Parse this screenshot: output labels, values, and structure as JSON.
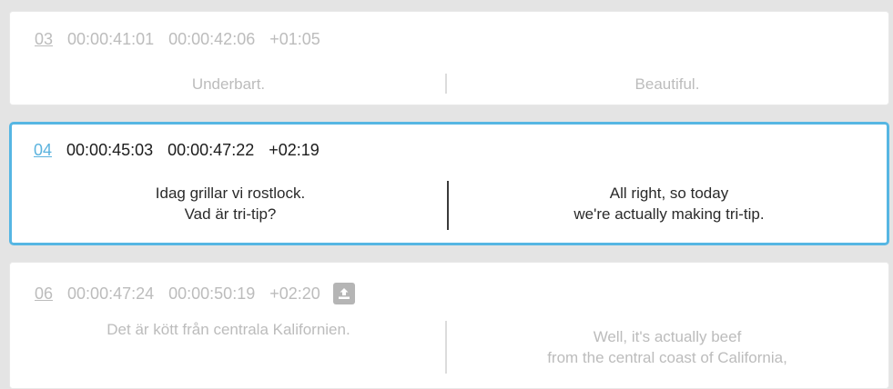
{
  "subtitles": [
    {
      "number": "03",
      "in": "00:00:41:01",
      "out": "00:00:42:06",
      "duration": "+01:05",
      "source_lines": [
        "Underbart."
      ],
      "target_lines": [
        "Beautiful."
      ],
      "state": "inactive"
    },
    {
      "number": "04",
      "in": "00:00:45:03",
      "out": "00:00:47:22",
      "duration": "+02:19",
      "source_lines": [
        "Idag grillar vi rostlock.",
        "Vad är tri-tip?"
      ],
      "target_lines": [
        "All right, so today",
        "we're actually making tri-tip."
      ],
      "state": "active"
    },
    {
      "number": "06",
      "in": "00:00:47:24",
      "out": "00:00:50:19",
      "duration": "+02:20",
      "source_lines": [
        "Det är kött från centrala Kalifornien."
      ],
      "target_lines": [
        "Well, it's actually beef",
        "from the central coast of California,"
      ],
      "state": "inactive",
      "icon": "upload-icon"
    }
  ],
  "colors": {
    "active_border": "#56b6e3",
    "active_number": "#5bb3de",
    "dim_text": "#bcbcbc",
    "background": "#e4e4e4"
  }
}
